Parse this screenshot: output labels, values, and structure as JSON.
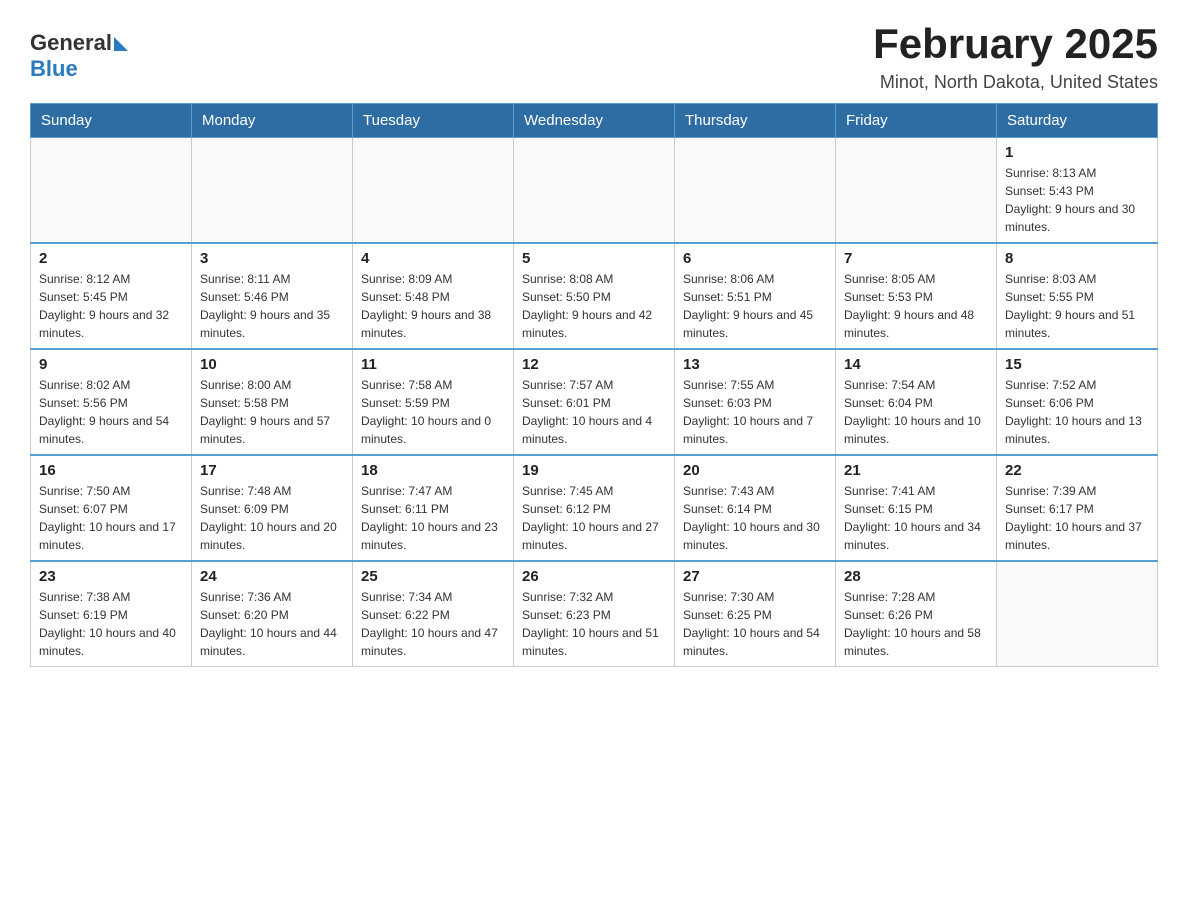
{
  "header": {
    "logo_general": "General",
    "logo_blue": "Blue",
    "title": "February 2025",
    "location": "Minot, North Dakota, United States"
  },
  "weekdays": [
    "Sunday",
    "Monday",
    "Tuesday",
    "Wednesday",
    "Thursday",
    "Friday",
    "Saturday"
  ],
  "weeks": [
    [
      {
        "day": "",
        "sunrise": "",
        "sunset": "",
        "daylight": ""
      },
      {
        "day": "",
        "sunrise": "",
        "sunset": "",
        "daylight": ""
      },
      {
        "day": "",
        "sunrise": "",
        "sunset": "",
        "daylight": ""
      },
      {
        "day": "",
        "sunrise": "",
        "sunset": "",
        "daylight": ""
      },
      {
        "day": "",
        "sunrise": "",
        "sunset": "",
        "daylight": ""
      },
      {
        "day": "",
        "sunrise": "",
        "sunset": "",
        "daylight": ""
      },
      {
        "day": "1",
        "sunrise": "Sunrise: 8:13 AM",
        "sunset": "Sunset: 5:43 PM",
        "daylight": "Daylight: 9 hours and 30 minutes."
      }
    ],
    [
      {
        "day": "2",
        "sunrise": "Sunrise: 8:12 AM",
        "sunset": "Sunset: 5:45 PM",
        "daylight": "Daylight: 9 hours and 32 minutes."
      },
      {
        "day": "3",
        "sunrise": "Sunrise: 8:11 AM",
        "sunset": "Sunset: 5:46 PM",
        "daylight": "Daylight: 9 hours and 35 minutes."
      },
      {
        "day": "4",
        "sunrise": "Sunrise: 8:09 AM",
        "sunset": "Sunset: 5:48 PM",
        "daylight": "Daylight: 9 hours and 38 minutes."
      },
      {
        "day": "5",
        "sunrise": "Sunrise: 8:08 AM",
        "sunset": "Sunset: 5:50 PM",
        "daylight": "Daylight: 9 hours and 42 minutes."
      },
      {
        "day": "6",
        "sunrise": "Sunrise: 8:06 AM",
        "sunset": "Sunset: 5:51 PM",
        "daylight": "Daylight: 9 hours and 45 minutes."
      },
      {
        "day": "7",
        "sunrise": "Sunrise: 8:05 AM",
        "sunset": "Sunset: 5:53 PM",
        "daylight": "Daylight: 9 hours and 48 minutes."
      },
      {
        "day": "8",
        "sunrise": "Sunrise: 8:03 AM",
        "sunset": "Sunset: 5:55 PM",
        "daylight": "Daylight: 9 hours and 51 minutes."
      }
    ],
    [
      {
        "day": "9",
        "sunrise": "Sunrise: 8:02 AM",
        "sunset": "Sunset: 5:56 PM",
        "daylight": "Daylight: 9 hours and 54 minutes."
      },
      {
        "day": "10",
        "sunrise": "Sunrise: 8:00 AM",
        "sunset": "Sunset: 5:58 PM",
        "daylight": "Daylight: 9 hours and 57 minutes."
      },
      {
        "day": "11",
        "sunrise": "Sunrise: 7:58 AM",
        "sunset": "Sunset: 5:59 PM",
        "daylight": "Daylight: 10 hours and 0 minutes."
      },
      {
        "day": "12",
        "sunrise": "Sunrise: 7:57 AM",
        "sunset": "Sunset: 6:01 PM",
        "daylight": "Daylight: 10 hours and 4 minutes."
      },
      {
        "day": "13",
        "sunrise": "Sunrise: 7:55 AM",
        "sunset": "Sunset: 6:03 PM",
        "daylight": "Daylight: 10 hours and 7 minutes."
      },
      {
        "day": "14",
        "sunrise": "Sunrise: 7:54 AM",
        "sunset": "Sunset: 6:04 PM",
        "daylight": "Daylight: 10 hours and 10 minutes."
      },
      {
        "day": "15",
        "sunrise": "Sunrise: 7:52 AM",
        "sunset": "Sunset: 6:06 PM",
        "daylight": "Daylight: 10 hours and 13 minutes."
      }
    ],
    [
      {
        "day": "16",
        "sunrise": "Sunrise: 7:50 AM",
        "sunset": "Sunset: 6:07 PM",
        "daylight": "Daylight: 10 hours and 17 minutes."
      },
      {
        "day": "17",
        "sunrise": "Sunrise: 7:48 AM",
        "sunset": "Sunset: 6:09 PM",
        "daylight": "Daylight: 10 hours and 20 minutes."
      },
      {
        "day": "18",
        "sunrise": "Sunrise: 7:47 AM",
        "sunset": "Sunset: 6:11 PM",
        "daylight": "Daylight: 10 hours and 23 minutes."
      },
      {
        "day": "19",
        "sunrise": "Sunrise: 7:45 AM",
        "sunset": "Sunset: 6:12 PM",
        "daylight": "Daylight: 10 hours and 27 minutes."
      },
      {
        "day": "20",
        "sunrise": "Sunrise: 7:43 AM",
        "sunset": "Sunset: 6:14 PM",
        "daylight": "Daylight: 10 hours and 30 minutes."
      },
      {
        "day": "21",
        "sunrise": "Sunrise: 7:41 AM",
        "sunset": "Sunset: 6:15 PM",
        "daylight": "Daylight: 10 hours and 34 minutes."
      },
      {
        "day": "22",
        "sunrise": "Sunrise: 7:39 AM",
        "sunset": "Sunset: 6:17 PM",
        "daylight": "Daylight: 10 hours and 37 minutes."
      }
    ],
    [
      {
        "day": "23",
        "sunrise": "Sunrise: 7:38 AM",
        "sunset": "Sunset: 6:19 PM",
        "daylight": "Daylight: 10 hours and 40 minutes."
      },
      {
        "day": "24",
        "sunrise": "Sunrise: 7:36 AM",
        "sunset": "Sunset: 6:20 PM",
        "daylight": "Daylight: 10 hours and 44 minutes."
      },
      {
        "day": "25",
        "sunrise": "Sunrise: 7:34 AM",
        "sunset": "Sunset: 6:22 PM",
        "daylight": "Daylight: 10 hours and 47 minutes."
      },
      {
        "day": "26",
        "sunrise": "Sunrise: 7:32 AM",
        "sunset": "Sunset: 6:23 PM",
        "daylight": "Daylight: 10 hours and 51 minutes."
      },
      {
        "day": "27",
        "sunrise": "Sunrise: 7:30 AM",
        "sunset": "Sunset: 6:25 PM",
        "daylight": "Daylight: 10 hours and 54 minutes."
      },
      {
        "day": "28",
        "sunrise": "Sunrise: 7:28 AM",
        "sunset": "Sunset: 6:26 PM",
        "daylight": "Daylight: 10 hours and 58 minutes."
      },
      {
        "day": "",
        "sunrise": "",
        "sunset": "",
        "daylight": ""
      }
    ]
  ]
}
